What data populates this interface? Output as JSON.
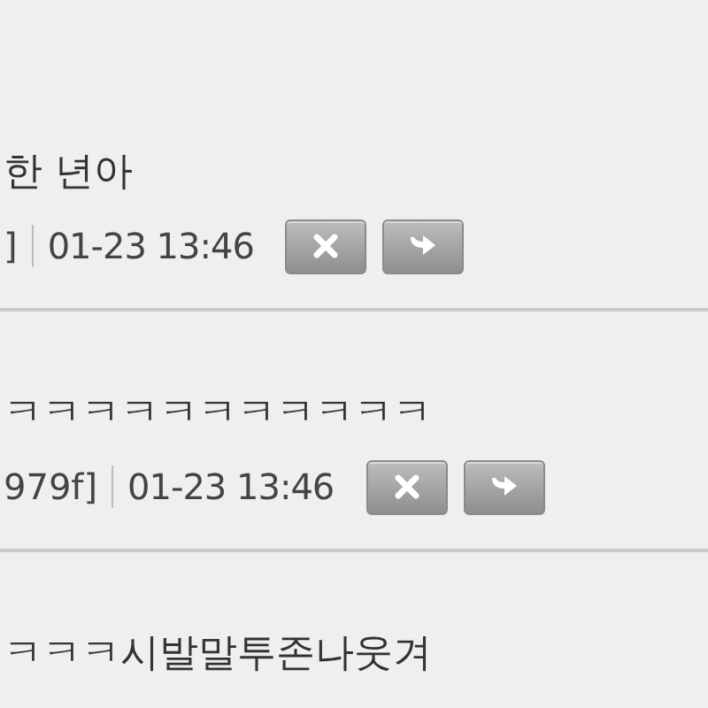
{
  "comments": [
    {
      "text": "한 년아",
      "author": "]",
      "date": "01-23 13:46"
    },
    {
      "text": "ㅋㅋㅋㅋㅋㅋㅋㅋㅋㅋㅋ",
      "author": "979f]",
      "date": "01-23 13:46"
    },
    {
      "text": "ㅋㅋㅋ시발말투존나웃겨"
    }
  ]
}
